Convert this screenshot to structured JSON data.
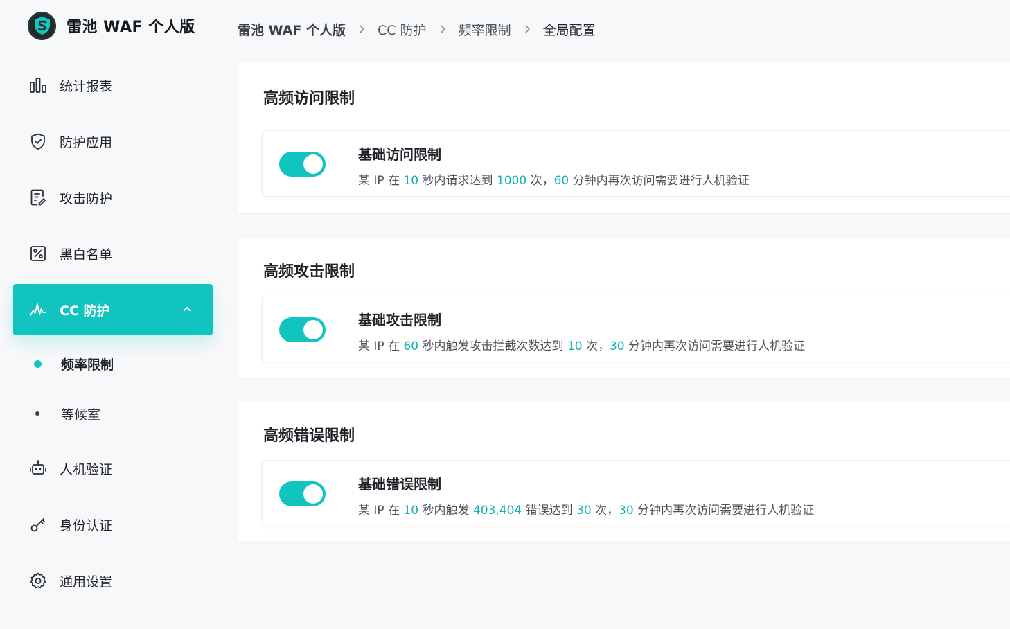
{
  "brand": {
    "title": "雷池 WAF 个人版",
    "logo_icon": "shield-s-logo"
  },
  "colors": {
    "accent": "#12c4bf",
    "accent_text": "#12b4b0"
  },
  "sidebar": {
    "items": [
      {
        "label": "统计报表",
        "icon": "bar-chart-icon"
      },
      {
        "label": "防护应用",
        "icon": "shield-check-icon"
      },
      {
        "label": "攻击防护",
        "icon": "document-edit-icon"
      },
      {
        "label": "黑白名单",
        "icon": "percent-square-icon"
      },
      {
        "label": "CC 防护",
        "icon": "activity-pulse-icon",
        "active": true,
        "expanded": true,
        "children": [
          {
            "label": "频率限制",
            "active": true
          },
          {
            "label": "等候室"
          }
        ]
      },
      {
        "label": "人机验证",
        "icon": "robot-icon"
      },
      {
        "label": "身份认证",
        "icon": "key-icon"
      },
      {
        "label": "通用设置",
        "icon": "gear-icon"
      }
    ]
  },
  "breadcrumb": [
    "雷池 WAF 个人版",
    "CC 防护",
    "频率限制",
    "全局配置"
  ],
  "sections": [
    {
      "title": "高频访问限制",
      "rule": {
        "name": "基础访问限制",
        "enabled": true,
        "desc": [
          {
            "t": "某 IP 在 "
          },
          {
            "n": "10"
          },
          {
            "t": " 秒内请求达到 "
          },
          {
            "n": "1000"
          },
          {
            "t": " 次，"
          },
          {
            "n": "60"
          },
          {
            "t": " 分钟内再次访问需要进行人机验证"
          }
        ]
      }
    },
    {
      "title": "高频攻击限制",
      "rule": {
        "name": "基础攻击限制",
        "enabled": true,
        "desc": [
          {
            "t": "某 IP 在 "
          },
          {
            "n": "60"
          },
          {
            "t": " 秒内触发攻击拦截次数达到 "
          },
          {
            "n": "10"
          },
          {
            "t": " 次，"
          },
          {
            "n": "30"
          },
          {
            "t": " 分钟内再次访问需要进行人机验证"
          }
        ]
      }
    },
    {
      "title": "高频错误限制",
      "rule": {
        "name": "基础错误限制",
        "enabled": true,
        "desc": [
          {
            "t": "某 IP 在 "
          },
          {
            "n": "10"
          },
          {
            "t": " 秒内触发 "
          },
          {
            "n": "403,404"
          },
          {
            "t": " 错误达到 "
          },
          {
            "n": "30"
          },
          {
            "t": " 次，"
          },
          {
            "n": "30"
          },
          {
            "t": " 分钟内再次访问需要进行人机验证"
          }
        ]
      }
    }
  ]
}
